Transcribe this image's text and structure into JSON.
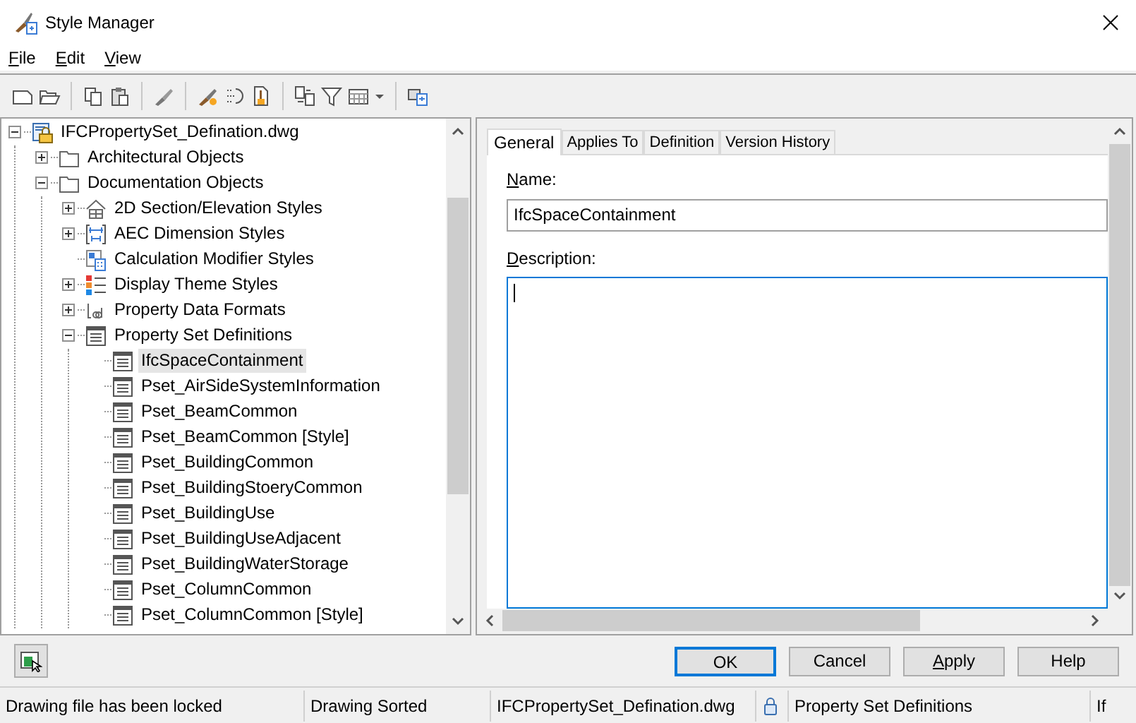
{
  "window": {
    "title": "Style Manager"
  },
  "menu": [
    "File",
    "Edit",
    "View"
  ],
  "tree": {
    "label": "IFCPropertySet_Defination.dwg",
    "kind": "drawing",
    "expanded": true,
    "selected": false,
    "children": [
      {
        "label": "Architectural Objects",
        "kind": "folder",
        "expanded": false,
        "selected": false
      },
      {
        "label": "Documentation Objects",
        "kind": "folder",
        "expanded": true,
        "selected": false,
        "children": [
          {
            "label": "2D Section/Elevation Styles",
            "kind": "section",
            "expanded": false,
            "selected": false
          },
          {
            "label": "AEC Dimension Styles",
            "kind": "dimension",
            "expanded": false,
            "selected": false
          },
          {
            "label": "Calculation Modifier Styles",
            "kind": "calc",
            "selected": false
          },
          {
            "label": "Display Theme Styles",
            "kind": "theme",
            "expanded": false,
            "selected": false
          },
          {
            "label": "Property Data Formats",
            "kind": "format",
            "expanded": false,
            "selected": false
          },
          {
            "label": "Property Set Definitions",
            "kind": "propset",
            "expanded": true,
            "selected": false,
            "children": [
              {
                "label": "IfcSpaceContainment",
                "kind": "propset",
                "selected": true
              },
              {
                "label": "Pset_AirSideSystemInformation",
                "kind": "propset",
                "selected": false
              },
              {
                "label": "Pset_BeamCommon",
                "kind": "propset",
                "selected": false
              },
              {
                "label": "Pset_BeamCommon [Style]",
                "kind": "propset",
                "selected": false
              },
              {
                "label": "Pset_BuildingCommon",
                "kind": "propset",
                "selected": false
              },
              {
                "label": "Pset_BuildingStoeryCommon",
                "kind": "propset",
                "selected": false
              },
              {
                "label": "Pset_BuildingUse",
                "kind": "propset",
                "selected": false
              },
              {
                "label": "Pset_BuildingUseAdjacent",
                "kind": "propset",
                "selected": false
              },
              {
                "label": "Pset_BuildingWaterStorage",
                "kind": "propset",
                "selected": false
              },
              {
                "label": "Pset_ColumnCommon",
                "kind": "propset",
                "selected": false
              },
              {
                "label": "Pset_ColumnCommon [Style]",
                "kind": "propset",
                "selected": false
              }
            ]
          }
        ]
      }
    ]
  },
  "tabs": [
    {
      "label": "General",
      "selected": true
    },
    {
      "label": "Applies To",
      "selected": false
    },
    {
      "label": "Definition",
      "selected": false
    },
    {
      "label": "Version History",
      "selected": false
    }
  ],
  "name_field": {
    "label": "Name:",
    "value": "IfcSpaceContainment"
  },
  "description_field": {
    "label": "Description:"
  },
  "buttons": [
    {
      "label": "OK",
      "default": true,
      "mnemonic": false
    },
    {
      "label": "Cancel",
      "default": false,
      "mnemonic": false
    },
    {
      "label": "Apply",
      "default": false,
      "mnemonic": true
    },
    {
      "label": "Help",
      "default": false,
      "mnemonic": false
    }
  ],
  "status_bar": [
    {
      "kind": "text",
      "text": "Drawing file has been locked"
    },
    {
      "kind": "text",
      "text": "Drawing Sorted"
    },
    {
      "kind": "text",
      "text": "IFCPropertySet_Defination.dwg"
    },
    {
      "kind": "lock"
    },
    {
      "kind": "text",
      "text": "Property Set Definitions"
    },
    {
      "kind": "text",
      "text": "If"
    }
  ]
}
